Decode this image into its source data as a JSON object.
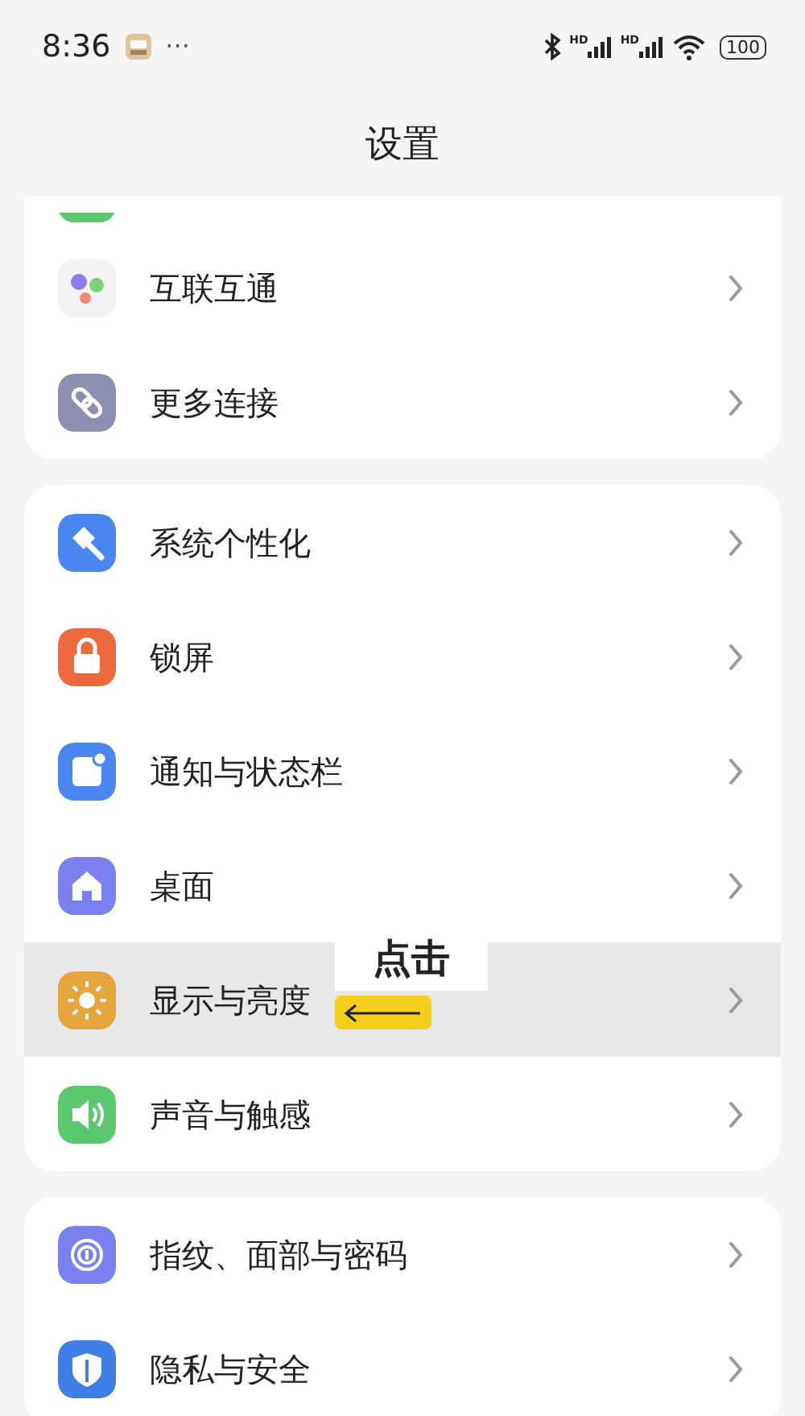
{
  "status_bar": {
    "time": "8:36",
    "more": "···",
    "signal_labels": [
      "HD",
      "HD"
    ],
    "battery": "100"
  },
  "title": "设置",
  "groups": [
    {
      "items": [
        {
          "label": "互联互通",
          "kind": "dots",
          "color": "#f3f3f3",
          "selected": false
        },
        {
          "label": "更多连接",
          "kind": "link",
          "color": "#8c8fae",
          "selected": false
        }
      ]
    },
    {
      "items": [
        {
          "label": "系统个性化",
          "kind": "brush",
          "color": "#4a86ef",
          "selected": false
        },
        {
          "label": "锁屏",
          "kind": "lock",
          "color": "#ea6a3d",
          "selected": false
        },
        {
          "label": "通知与状态栏",
          "kind": "notification",
          "color": "#4a86ef",
          "selected": false
        },
        {
          "label": "桌面",
          "kind": "home",
          "color": "#7c80ef",
          "selected": false
        },
        {
          "label": "显示与亮度",
          "kind": "sun",
          "color": "#e6a43c",
          "selected": true,
          "annotation": {
            "label": "点击"
          }
        },
        {
          "label": "声音与触感",
          "kind": "speaker",
          "color": "#5cc86e",
          "selected": false
        }
      ]
    },
    {
      "items": [
        {
          "label": "指纹、面部与密码",
          "kind": "fingerprint",
          "color": "#7c80ef",
          "selected": false
        },
        {
          "label": "隐私与安全",
          "kind": "shield",
          "color": "#3f7fe6",
          "selected": false
        }
      ]
    }
  ]
}
